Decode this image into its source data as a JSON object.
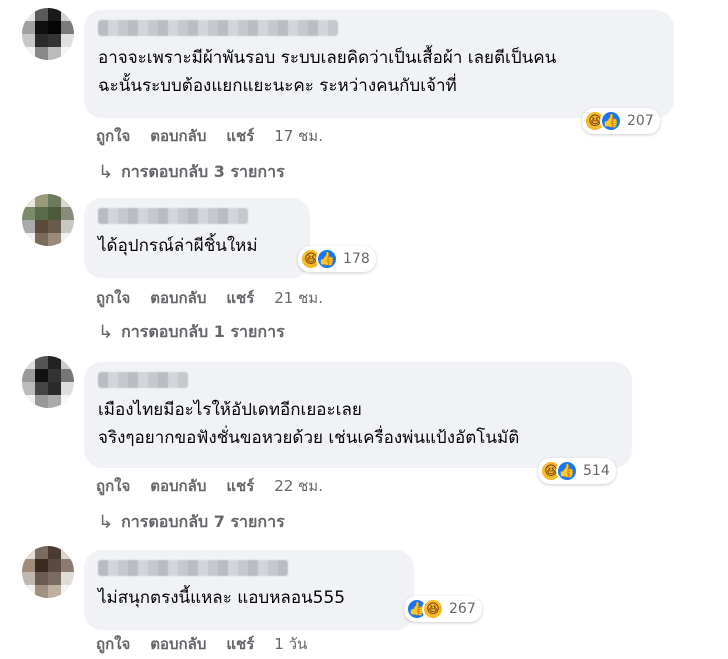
{
  "comments": [
    {
      "lines": [
        "อาจจะเพราะมีผ้าพันรอบ ระบบเลยคิดว่าเป็นเสื้อผ้า เลยตีเป็นคน",
        "ฉะนั้นระบบต้องแยกแยะนะคะ ระหว่างคนกับเจ้าที่"
      ],
      "reaction_count": "207",
      "actions": {
        "like": "ถูกใจ",
        "reply": "ตอบกลับ",
        "share": "แชร์",
        "time": "17 ชม."
      },
      "replies_label": "การตอบกลับ 3 รายการ"
    },
    {
      "lines": [
        "ได้อุปกรณ์ล่าผีชิ้นใหม่"
      ],
      "reaction_count": "178",
      "actions": {
        "like": "ถูกใจ",
        "reply": "ตอบกลับ",
        "share": "แชร์",
        "time": "21 ชม."
      },
      "replies_label": "การตอบกลับ 1 รายการ"
    },
    {
      "lines": [
        "เมืองไทยมีอะไรให้อัปเดทอีกเยอะเลย",
        "จริงๆอยากขอฟังชั่นขอหวยด้วย เช่นเครื่องพ่นแป้งอัตโนมัติ"
      ],
      "reaction_count": "514",
      "actions": {
        "like": "ถูกใจ",
        "reply": "ตอบกลับ",
        "share": "แชร์",
        "time": "22 ชม."
      },
      "replies_label": "การตอบกลับ 7 รายการ"
    },
    {
      "lines": [
        "ไม่สนุกตรงนี้แหละ แอบหลอน555"
      ],
      "reaction_count": "267",
      "actions": {
        "like": "ถูกใจ",
        "reply": "ตอบกลับ",
        "share": "แชร์",
        "time": "1 วัน"
      }
    }
  ],
  "icons": {
    "reaction_haha": "haha-emoji-icon",
    "reaction_like": "thumbs-up-icon",
    "reply_arrow": "reply-arrow-icon"
  },
  "colors": {
    "bubble": "#f0f2f5",
    "like_blue": "#1877f2",
    "haha_yellow": "#f7b928",
    "muted_text": "#65676b"
  }
}
